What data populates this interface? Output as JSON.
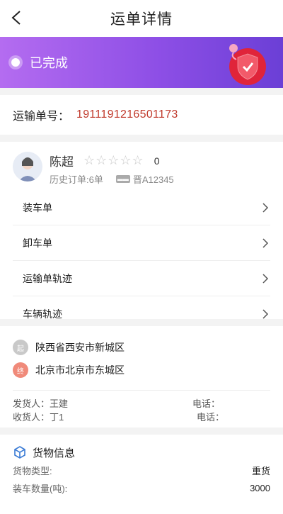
{
  "header": {
    "title": "运单详情"
  },
  "status": {
    "text": "已完成"
  },
  "tracking": {
    "label": "运输单号：",
    "number": "1911191216501173"
  },
  "driver": {
    "name": "陈超",
    "stars": "☆☆☆☆☆",
    "rating": "0",
    "history_orders": "历史订单:6单",
    "plate": "晋A12345"
  },
  "menu": [
    {
      "label": "装车单"
    },
    {
      "label": "卸车单"
    },
    {
      "label": "运输单轨迹"
    },
    {
      "label": "车辆轨迹"
    }
  ],
  "route": {
    "origin_badge": "起",
    "origin": "陕西省西安市新城区",
    "dest_badge": "终",
    "destination": "北京市北京市东城区",
    "origin_color": "#c9c9c9",
    "dest_color": "#f08a7a"
  },
  "parties": {
    "sender": "发货人：王建",
    "sender_phone": "电话：",
    "receiver": "收货人：丁1",
    "receiver_phone": "电话："
  },
  "goods": {
    "section_title": "货物信息",
    "rows": [
      {
        "label": "货物类型:",
        "value": "重货"
      },
      {
        "label": "装车数量(吨):",
        "value": "3000"
      }
    ]
  },
  "colors": {
    "accent": "#8e4fe6",
    "tracking_number": "#c0392b"
  }
}
